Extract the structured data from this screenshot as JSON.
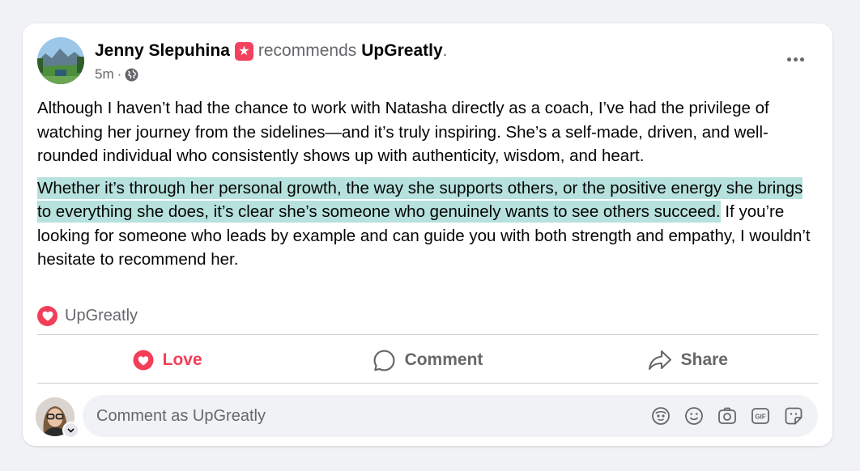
{
  "post": {
    "author": "Jenny Slepuhina",
    "recommends_text": "recommends",
    "page_name": "UpGreatly",
    "page_name_suffix": ".",
    "time": "5m",
    "meta_sep": "·",
    "body_para1": "Although I haven’t had the chance to work with Natasha directly as a coach, I’ve had the privilege of watching her journey from the sidelines—and it’s truly inspiring. She’s a self-made, driven, and well-rounded individual who consistently shows up with authenticity, wisdom, and heart.",
    "body_para2_highlighted": "Whether it’s through her personal growth, the way she supports others, or the positive energy she brings to everything she does, it’s clear she’s someone who genuinely wants to see others succeed.",
    "body_para2_rest": " If you’re looking for someone who leads by example and can guide you with both strength and empathy, I wouldn’t hesitate to recommend her.",
    "highlight_color": "#b6e1dd"
  },
  "reactions": {
    "summary": "UpGreatly",
    "icon": "love-reaction-icon"
  },
  "actions": {
    "love_label": "Love",
    "comment_label": "Comment",
    "share_label": "Share",
    "love_color": "#f33e58"
  },
  "comment_box": {
    "placeholder": "Comment as UpGreatly",
    "icons": [
      "avatar-sticker-icon",
      "emoji-icon",
      "camera-icon",
      "gif-icon",
      "sticker-icon"
    ]
  },
  "colors": {
    "background": "#f0f2f5",
    "card": "#ffffff",
    "secondary_text": "#65676b",
    "badge": "#f3425f"
  }
}
